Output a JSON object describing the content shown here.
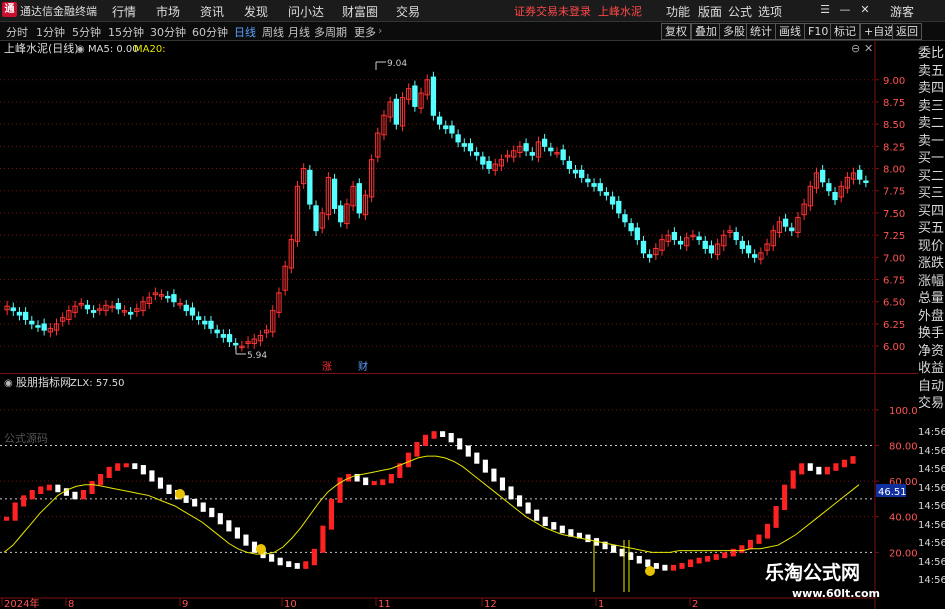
{
  "app": {
    "title": "通达信金融终端",
    "logo": "红色方框logo-icon"
  },
  "menu": [
    "行情",
    "市场",
    "资讯",
    "发现",
    "问小达",
    "财富圈",
    "交易"
  ],
  "status_message": "证券交易未登录",
  "stock_name": "上峰水泥",
  "toolbar_right": [
    "功能",
    "版面",
    "公式",
    "选项"
  ],
  "guest": "游客",
  "periods": [
    "分时",
    "1分钟",
    "5分钟",
    "15分钟",
    "30分钟",
    "60分钟",
    "日线",
    "周线",
    "月线",
    "多周期",
    "更多"
  ],
  "active_period": "日线",
  "right_buttons": [
    "复权",
    "叠加",
    "多股",
    "统计",
    "画线",
    "F10",
    "标记",
    "+自选",
    "返回"
  ],
  "main_chart": {
    "title": "上峰水泥(日线)",
    "ma5_label": "MA5: 0.00",
    "ma20_label": "MA20:",
    "max_label": "9.04",
    "min_label": "5.94",
    "y_ticks": [
      "9.00",
      "8.75",
      "8.50",
      "8.25",
      "8.00",
      "7.75",
      "7.50",
      "7.25",
      "7.00",
      "6.75",
      "6.50",
      "6.25",
      "6.00"
    ],
    "event_markers": [
      "涨",
      "财"
    ]
  },
  "indicator": {
    "title": "股朋指标网",
    "value_label": "ZLX: 57.50",
    "formula_watermark": "公式源码",
    "y_ticks": [
      "100.0",
      "80.00",
      "60.00",
      "40.00",
      "20.00"
    ],
    "current_value": "46.51",
    "x_labels": [
      "2024年",
      "8",
      "9",
      "10",
      "11",
      "12",
      "1",
      "2"
    ]
  },
  "quote_side": [
    "委比",
    "卖五",
    "卖四",
    "卖三",
    "卖二",
    "卖一",
    "买一",
    "买二",
    "买三",
    "买四",
    "买五",
    "现价",
    "涨跌",
    "涨幅",
    "总量",
    "外盘",
    "换手",
    "净资",
    "收益",
    "自动",
    "交易"
  ],
  "time_side": [
    "14:56",
    "14:56",
    "14:56",
    "14:56",
    "14:56",
    "14:56",
    "14:56",
    "14:56",
    "14:56"
  ],
  "colors": {
    "up": "#ff3333",
    "down": "#55ffff",
    "bg": "#000000",
    "grid": "#7a1010",
    "ma": "#e6e600",
    "accent_blue": "#5aa0ff"
  },
  "chart_data": {
    "type": "candlestick",
    "title": "上峰水泥(日线)",
    "ylim": [
      5.9,
      9.2
    ],
    "x_labels": [
      "2024年",
      "8",
      "9",
      "10",
      "11",
      "12",
      "1",
      "2"
    ],
    "annotations": {
      "high": 9.04,
      "low": 5.94
    },
    "closes": [
      6.45,
      6.4,
      6.35,
      6.3,
      6.25,
      6.22,
      6.18,
      6.2,
      6.25,
      6.32,
      6.4,
      6.45,
      6.48,
      6.42,
      6.38,
      6.42,
      6.46,
      6.45,
      6.42,
      6.4,
      6.36,
      6.42,
      6.5,
      6.55,
      6.6,
      6.58,
      6.55,
      6.5,
      6.48,
      6.4,
      6.35,
      6.3,
      6.25,
      6.2,
      6.15,
      6.1,
      6.05,
      6.02,
      6.0,
      6.05,
      6.08,
      6.12,
      6.18,
      6.4,
      6.6,
      6.9,
      7.2,
      7.8,
      8.0,
      7.6,
      7.3,
      7.5,
      7.9,
      7.55,
      7.4,
      7.6,
      7.8,
      7.5,
      7.7,
      8.1,
      8.4,
      8.6,
      8.75,
      8.5,
      8.8,
      8.9,
      8.7,
      8.85,
      9.0,
      8.6,
      8.5,
      8.45,
      8.4,
      8.3,
      8.25,
      8.2,
      8.15,
      8.05,
      8.0,
      8.05,
      8.1,
      8.15,
      8.2,
      8.25,
      8.2,
      8.15,
      8.3,
      8.25,
      8.2,
      8.18,
      8.1,
      8.0,
      7.95,
      7.9,
      7.85,
      7.8,
      7.75,
      7.7,
      7.6,
      7.5,
      7.4,
      7.3,
      7.2,
      7.05,
      7.0,
      7.1,
      7.2,
      7.25,
      7.2,
      7.15,
      7.22,
      7.25,
      7.2,
      7.1,
      7.05,
      7.15,
      7.25,
      7.3,
      7.2,
      7.1,
      7.05,
      7.0,
      7.05,
      7.15,
      7.3,
      7.4,
      7.35,
      7.3,
      7.45,
      7.6,
      7.8,
      7.95,
      7.85,
      7.75,
      7.65,
      7.8,
      7.9,
      7.95,
      7.88,
      7.85
    ],
    "indicator_series": [
      {
        "name": "ZLX",
        "values": [
          40,
          48,
          52,
          55,
          57,
          58,
          56,
          54,
          52,
          55,
          60,
          64,
          68,
          70,
          70,
          69,
          66,
          62,
          58,
          55,
          52,
          50,
          48,
          45,
          42,
          38,
          34,
          30,
          26,
          22,
          19,
          17,
          15,
          14,
          13,
          15,
          22,
          35,
          50,
          62,
          64,
          62,
          60,
          60,
          61,
          64,
          70,
          76,
          82,
          86,
          88,
          87,
          84,
          80,
          76,
          72,
          67,
          62,
          57,
          52,
          48,
          44,
          40,
          37,
          35,
          33,
          31,
          30,
          28,
          26,
          24,
          22,
          20,
          18,
          16,
          14,
          13,
          12,
          13,
          14,
          16,
          17,
          18,
          19,
          20,
          22,
          24,
          27,
          30,
          36,
          46,
          58,
          66,
          70,
          68,
          66,
          68,
          70,
          72,
          74
        ]
      },
      {
        "name": "MA",
        "values": [
          20,
          24,
          30,
          36,
          42,
          47,
          52,
          55,
          57,
          58,
          58,
          57,
          56,
          55,
          54,
          53,
          52,
          50,
          48,
          46,
          43,
          40,
          37,
          33,
          29,
          25,
          22,
          20,
          19,
          19,
          20,
          23,
          28,
          34,
          41,
          48,
          54,
          58,
          61,
          63,
          64,
          65,
          66,
          67,
          69,
          71,
          73,
          74,
          74,
          73,
          71,
          68,
          64,
          60,
          56,
          52,
          48,
          44,
          40,
          37,
          34,
          32,
          30,
          29,
          28,
          27,
          26,
          25,
          24,
          23,
          22,
          21,
          20,
          20,
          20,
          21,
          21,
          21,
          21,
          21,
          21,
          21,
          21,
          22,
          22,
          23,
          24,
          27,
          30,
          34,
          38,
          42,
          46,
          50,
          54,
          58
        ]
      }
    ]
  }
}
